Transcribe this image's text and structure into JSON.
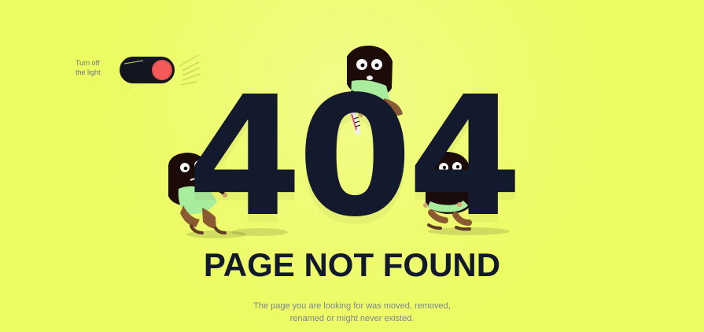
{
  "toggle": {
    "label": "Turn off\nthe light"
  },
  "error": {
    "code": "404",
    "title": "PAGE NOT FOUND",
    "message_line_1": "The page you are looking for was moved, removed,",
    "message_line_2": "renamed or might never existed."
  },
  "colors": {
    "background": "#ecfb61",
    "text_dark": "#13192d",
    "muted": "#7d8390",
    "toggle_dark": "#131620",
    "toggle_red": "#f45a5a",
    "shirt_green": "#a8ec9d",
    "character_dark": "#1b0c0a",
    "pants_brown": "#8a5b32"
  },
  "icons": {
    "toggle_icon": "toggle-icon",
    "saw_icon": "saw-icon"
  }
}
